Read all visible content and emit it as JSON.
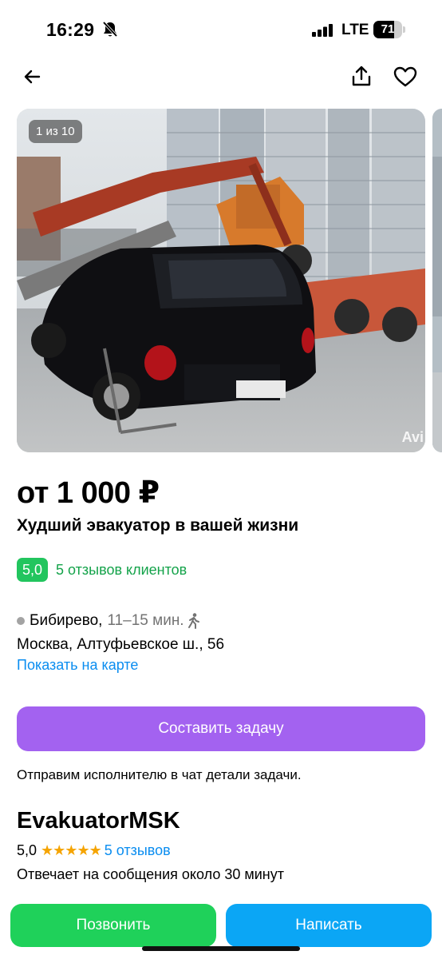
{
  "status_bar": {
    "time": "16:29",
    "network": "LTE",
    "battery_percent": "71",
    "icons": [
      "bell-off-icon",
      "signal-icon",
      "battery-icon"
    ]
  },
  "nav": {
    "icons": [
      "back-arrow-icon",
      "share-icon",
      "heart-icon"
    ]
  },
  "gallery": {
    "counter": "1 из 10",
    "watermark": "Avi"
  },
  "listing": {
    "price": "от 1 000 ₽",
    "title": "Худший эвакуатор в вашей жизни"
  },
  "rating": {
    "score": "5,0",
    "reviews_label": "5 отзывов клиентов",
    "color": "#22c55e"
  },
  "location": {
    "metro": "Бибирево,",
    "metro_time": "11–15 мин.",
    "address": "Москва, Алтуфьевское ш., 56",
    "map_link": "Показать на карте"
  },
  "task": {
    "button_label": "Составить задачу",
    "hint": "Отправим исполнителю в чат детали задачи.",
    "button_color": "#a362f0"
  },
  "seller": {
    "name": "EvakuatorMSK",
    "score": "5,0",
    "stars": "★★★★★",
    "star_count": 5,
    "reviews_link": "5 отзывов",
    "response_time": "Отвечает на сообщения около 30 минут"
  },
  "actions": {
    "call_label": "Позвонить",
    "write_label": "Написать",
    "call_color": "#1fd15a",
    "write_color": "#0ba6f5"
  }
}
